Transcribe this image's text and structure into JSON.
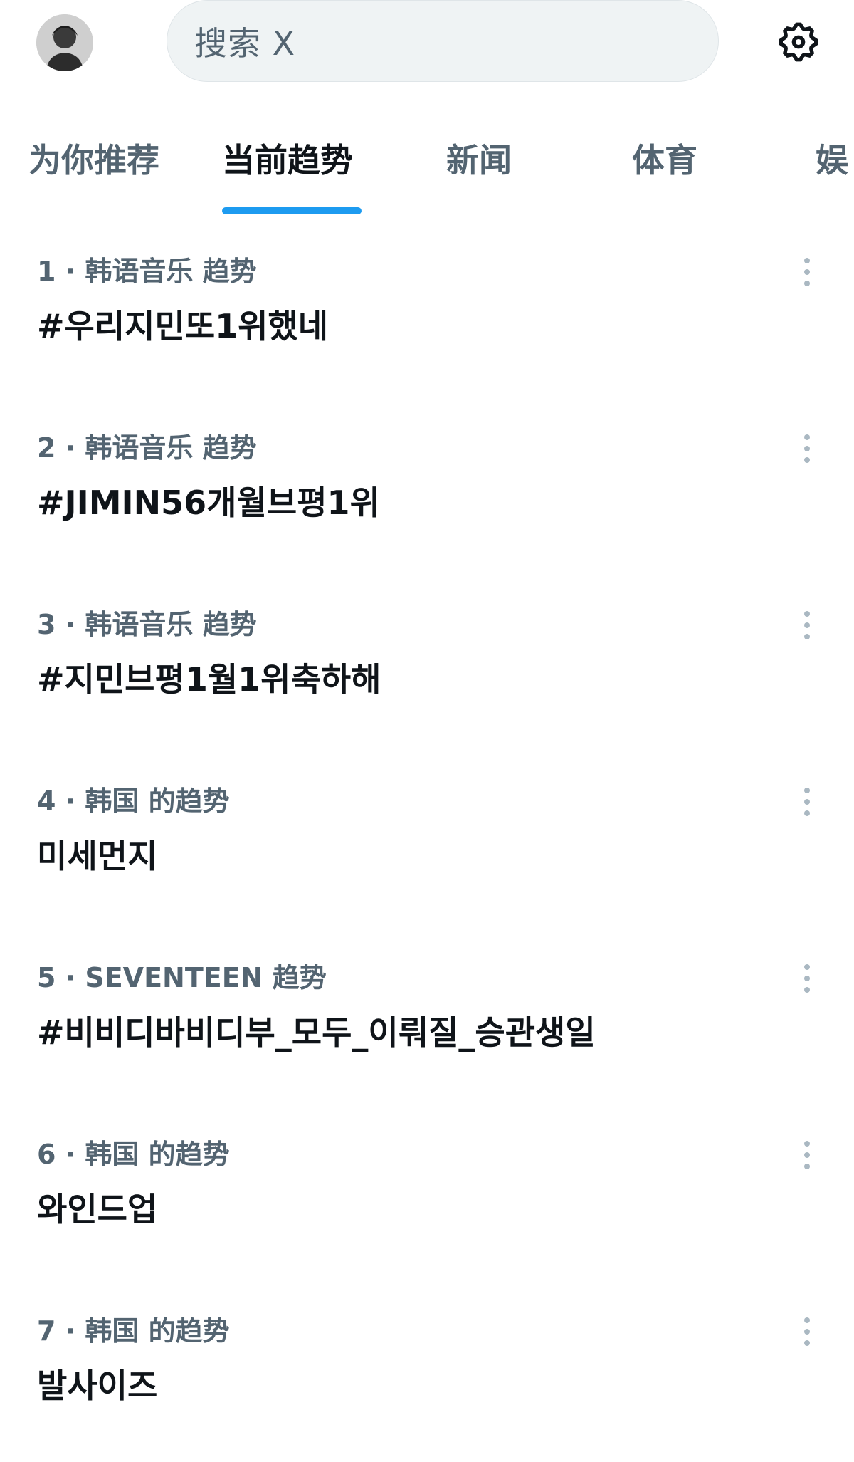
{
  "search": {
    "placeholder": "搜索 X"
  },
  "icons": {
    "avatar": "profile-avatar",
    "settings": "gear-icon",
    "more": "more-vertical-icon"
  },
  "colors": {
    "accent": "#1d9bf0",
    "secondary_text": "#536471",
    "primary_text": "#0f1419"
  },
  "tabs": [
    {
      "label": "为你推荐",
      "active": false
    },
    {
      "label": "当前趋势",
      "active": true
    },
    {
      "label": "新闻",
      "active": false
    },
    {
      "label": "体育",
      "active": false
    },
    {
      "label": "娱",
      "active": false
    }
  ],
  "trends": [
    {
      "meta": "1 · 韩语音乐 趋势",
      "name": "#우리지민또1위했네"
    },
    {
      "meta": "2 · 韩语音乐 趋势",
      "name": "#JIMIN56개월브평1위"
    },
    {
      "meta": "3 · 韩语音乐 趋势",
      "name": "#지민브평1월1위축하해"
    },
    {
      "meta": "4 · 韩国 的趋势",
      "name": "미세먼지"
    },
    {
      "meta": "5 · SEVENTEEN 趋势",
      "name": "#비비디바비디부_모두_이뤄질_승관생일"
    },
    {
      "meta": "6 · 韩国 的趋势",
      "name": "와인드업"
    },
    {
      "meta": "7 · 韩国 的趋势",
      "name": "발사이즈"
    }
  ]
}
